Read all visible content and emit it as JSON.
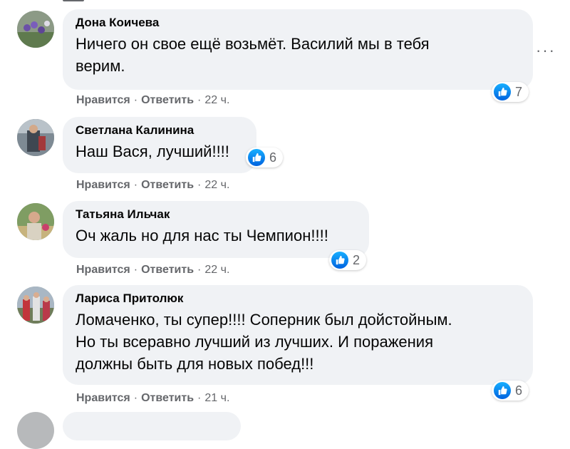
{
  "comments": [
    {
      "author": "Дона Коичева",
      "text_lines": [
        "Ничего он свое ещё возьмёт. Василий мы в тебя",
        "верим."
      ],
      "reaction_count": "7",
      "like_label": "Нравится",
      "reply_label": "Ответить",
      "time": "22 ч."
    },
    {
      "author": "Светлана Калинина",
      "text_lines": [
        "Наш Вася, лучший!!!!"
      ],
      "reaction_count": "6",
      "like_label": "Нравится",
      "reply_label": "Ответить",
      "time": "22 ч."
    },
    {
      "author": "Татьяна Ильчак",
      "text_lines": [
        "Оч жаль но для нас ты Чемпион!!!!"
      ],
      "reaction_count": "2",
      "like_label": "Нравится",
      "reply_label": "Ответить",
      "time": "22 ч."
    },
    {
      "author": "Лариса Притолюк",
      "text_lines": [
        "Ломаченко, ты супер!!!! Соперник был дойстойным.",
        "Но ты всеравно лучший из лучших. И поражения",
        "должны быть для новых побед!!!"
      ],
      "reaction_count": "6",
      "like_label": "Нравится",
      "reply_label": "Ответить",
      "time": "21 ч."
    }
  ],
  "separator": "·",
  "more_glyph": "···",
  "icons": {
    "reaction": "like-icon",
    "menu": "more-options-icon"
  },
  "colors": {
    "bubble": "#f0f2f5",
    "meta": "#65676b",
    "like_blue": "#1877f2"
  }
}
